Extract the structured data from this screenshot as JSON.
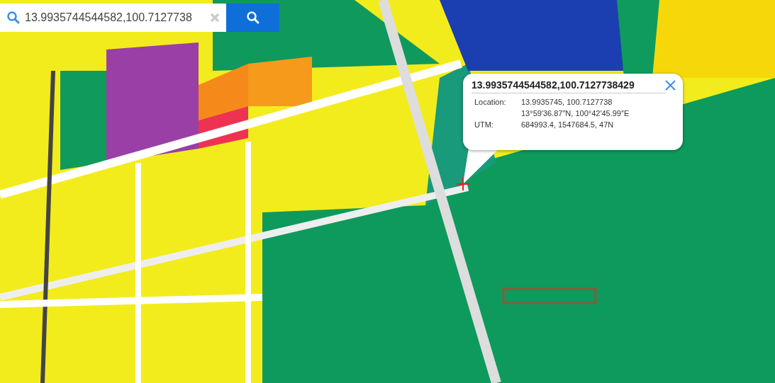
{
  "search": {
    "value": "13.9935744544582,100.7127738"
  },
  "popup": {
    "title": "13.9935744544582,100.7127738429",
    "rows": [
      {
        "label": "Location:",
        "value": "13.9935745, 100.7127738"
      },
      {
        "value": "13°59′36.87″N, 100°42′45.99″E"
      },
      {
        "label": "UTM:",
        "value": "684993.4, 1547684.5, 47N"
      }
    ]
  }
}
